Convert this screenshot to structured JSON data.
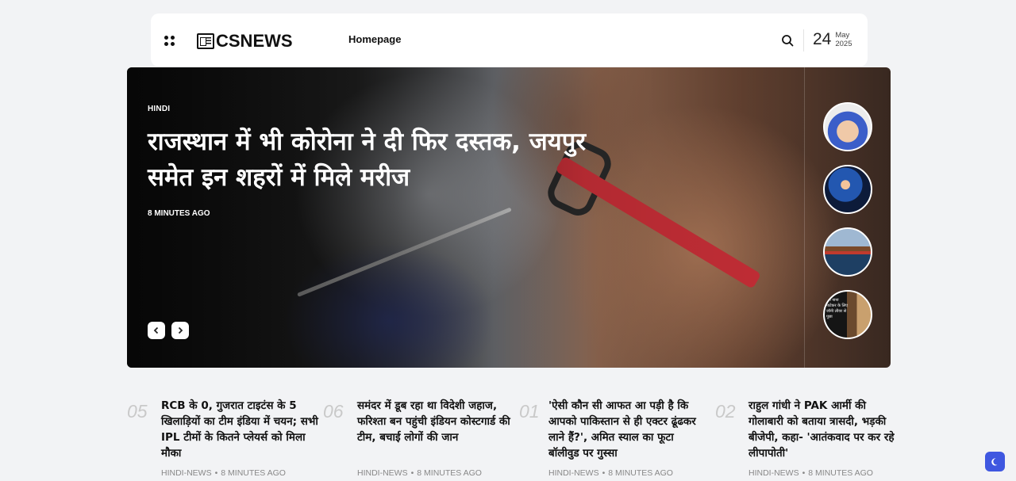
{
  "header": {
    "logo_text": "CSNEWS",
    "nav": [
      "Homepage"
    ],
    "date": {
      "day": "24",
      "month": "May",
      "year": "2025"
    }
  },
  "hero": {
    "category": "HINDI",
    "title": "राजस्थान में भी कोरोना ने दी फिर दस्तक, जयपुर समेत इन शहरों में मिले मरीज",
    "time": "8 MINUTES AGO",
    "prev_icon": "chevron-left-icon",
    "next_icon": "chevron-right-icon",
    "thumbnails": [
      {
        "name": "covid-test-thumbnail"
      },
      {
        "name": "cricketer-thumbnail"
      },
      {
        "name": "cargo-ship-thumbnail"
      },
      {
        "name": "news-person-thumbnail",
        "caption": "मैंने नाना पाटेकर के लिए जॉनी लीवर से पूछा"
      }
    ]
  },
  "articles": [
    {
      "number": "05",
      "title": "RCB के 0, गुजरात टाइटंस के 5 खिलाड़ियों का टीम इंडिया में चयन; सभी IPL टीमों के कितने प्लेयर्स को मिला मौका",
      "category": "HINDI-NEWS",
      "time": "8 MINUTES AGO"
    },
    {
      "number": "06",
      "title": "समंदर में डूब रहा था विदेशी जहाज, फरिश्ता बन पहुंची इंडियन कोस्टगार्ड की टीम, बचाई लोगों की जान",
      "category": "HINDI-NEWS",
      "time": "8 MINUTES AGO"
    },
    {
      "number": "01",
      "title": "'ऐसी कौन सी आफत आ पड़ी है कि आपको पाकिस्तान से ही एक्टर ढूंढकर लाने हैं?', अमित स्याल का फूटा बॉलीवुड पर गुस्सा",
      "category": "HINDI-NEWS",
      "time": "8 MINUTES AGO"
    },
    {
      "number": "02",
      "title": "राहुल गांधी ने PAK आर्मी की गोलाबारी को बताया त्रासदी, भड़की बीजेपी, कहा- 'आतंकवाद पर कर रहे लीपापोती'",
      "category": "HINDI-NEWS",
      "time": "8 MINUTES AGO"
    }
  ],
  "meta_separator": "•",
  "icons": {
    "menu": "menu-dots-icon",
    "search": "search-icon",
    "theme": "moon-icon"
  },
  "colors": {
    "accent": "#3f57e0",
    "background": "#f2f3f5",
    "glasses_red": "#d2313a"
  }
}
